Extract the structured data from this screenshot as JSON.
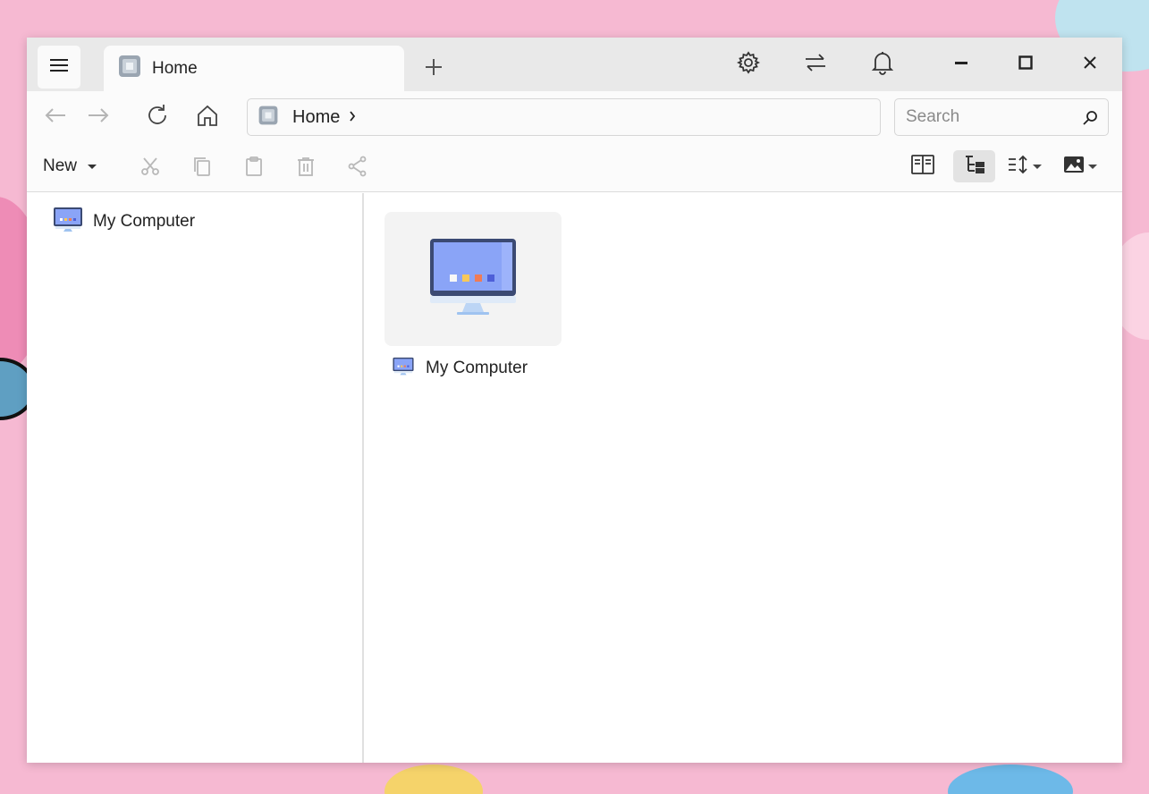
{
  "window": {
    "tab": {
      "title": "Home",
      "icon": "home-cube-icon"
    },
    "titlebar_icons": [
      "settings-icon",
      "sync-icon",
      "bell-icon"
    ],
    "window_controls": [
      "minimize-icon",
      "maximize-icon",
      "close-icon"
    ]
  },
  "navbar": {
    "address": {
      "label": "Home"
    },
    "search": {
      "placeholder": "Search"
    }
  },
  "cmdbar": {
    "new_label": "New",
    "actions": [
      "cut-icon",
      "copy-icon",
      "paste-icon",
      "delete-icon",
      "share-icon"
    ]
  },
  "sidebar": {
    "items": [
      {
        "label": "My Computer",
        "icon": "computer-icon"
      }
    ]
  },
  "content": {
    "items": [
      {
        "label": "My Computer",
        "icon": "computer-icon"
      }
    ]
  },
  "colors": {
    "accent": "#8aa4f7",
    "monitor_frame": "#3b4a73",
    "wallpaper": "#f6b9d2"
  }
}
